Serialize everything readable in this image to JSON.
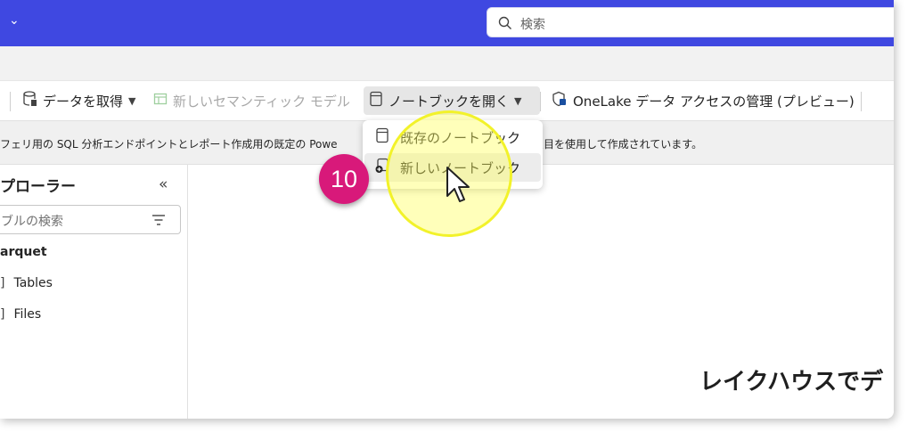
{
  "search": {
    "placeholder": "検索"
  },
  "toolbar": {
    "get_data": "データを取得",
    "new_semantic_model": "新しいセマンティック モデル",
    "open_notebook": "ノートブックを開く",
    "onelake_access": "OneLake データ アクセスの管理 (プレビュー)"
  },
  "info": {
    "text_left": "フェリ用の SQL 分析エンドポイントとレポート作成用の既定の Powe",
    "text_right": "頁目を使用して作成されています。"
  },
  "explorer": {
    "title": "プローラー",
    "search_placeholder": "ブルの検索",
    "root": "arquet",
    "items": [
      "Tables",
      "Files"
    ]
  },
  "dropdown": {
    "items": [
      "既存のノートブック",
      "新しいノートブック"
    ]
  },
  "annotation": {
    "step": "10"
  },
  "main": {
    "heading": "レイクハウスでデ"
  },
  "colors": {
    "header": "#3f48e1",
    "badge": "#d8197a",
    "highlight": "#f2f22a"
  }
}
